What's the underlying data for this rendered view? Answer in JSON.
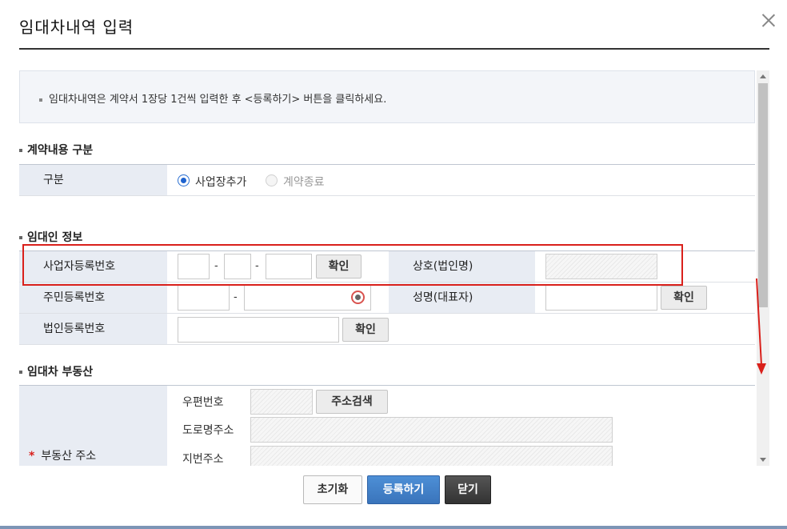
{
  "modal": {
    "title": "임대차내역 입력"
  },
  "notice": {
    "text": "임대차내역은 계약서 1장당 1건씩 입력한 후 <등록하기> 버튼을 클릭하세요."
  },
  "contract_type": {
    "section_title": "계약내용 구분",
    "label": "구분",
    "options": [
      {
        "label": "사업장추가",
        "checked": true,
        "disabled": false
      },
      {
        "label": "계약종료",
        "checked": false,
        "disabled": true
      }
    ]
  },
  "lessor": {
    "section_title": "임대인 정보",
    "business_reg_label": "사업자등록번호",
    "business_reg_confirm": "확인",
    "company_label": "상호(법인명)",
    "resident_reg_label": "주민등록번호",
    "name_label": "성명(대표자)",
    "name_confirm": "확인",
    "corporate_reg_label": "법인등록번호",
    "corporate_reg_confirm": "확인",
    "dash": "-"
  },
  "property": {
    "section_title": "임대차 부동산",
    "label": "부동산 주소",
    "required_mark": "*",
    "postcode_label": "우편번호",
    "address_search": "주소검색",
    "road_address_label": "도로명주소",
    "lot_address_label": "지번주소"
  },
  "footer": {
    "reset": "초기화",
    "register": "등록하기",
    "close": "닫기"
  },
  "colors": {
    "highlight": "#d9201b",
    "primary_button": "#3a74bb",
    "header_cell": "#e8ecf3"
  }
}
